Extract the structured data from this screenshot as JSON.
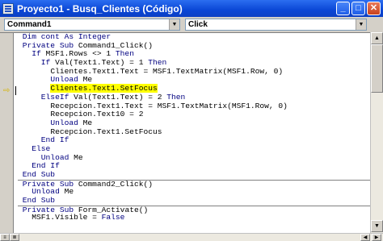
{
  "window": {
    "title": "Proyecto1 - Busq_Clientes (Código)"
  },
  "object_combo": {
    "value": "Command1"
  },
  "procedure_combo": {
    "value": "Click"
  },
  "code_lines": [
    {
      "indent": 1,
      "parts": [
        {
          "t": "Dim cont As Integer",
          "k": true
        }
      ]
    },
    {
      "indent": 1,
      "parts": [
        {
          "t": "Private Sub",
          "k": true
        },
        {
          "t": " Command1_Click()"
        }
      ]
    },
    {
      "indent": 3,
      "parts": [
        {
          "t": "If",
          "k": true
        },
        {
          "t": " MSF1.Rows <> 1 "
        },
        {
          "t": "Then",
          "k": true
        }
      ]
    },
    {
      "indent": 5,
      "parts": [
        {
          "t": "If",
          "k": true
        },
        {
          "t": " Val(Text1.Text) = 1 "
        },
        {
          "t": "Then",
          "k": true
        }
      ]
    },
    {
      "indent": 7,
      "parts": [
        {
          "t": "Clientes.Text1.Text = MSF1.TextMatrix(MSF1.Row, 0)"
        }
      ]
    },
    {
      "indent": 7,
      "parts": [
        {
          "t": "Unload",
          "k": true
        },
        {
          "t": " Me"
        }
      ]
    },
    {
      "indent": 7,
      "parts": [
        {
          "t": "Clientes.Text1.SetFocus",
          "h": true
        }
      ]
    },
    {
      "indent": 5,
      "parts": [
        {
          "t": "ElseIf",
          "k": true
        },
        {
          "t": " Val(Text1.Text) = 2 "
        },
        {
          "t": "Then",
          "k": true
        }
      ]
    },
    {
      "indent": 7,
      "parts": [
        {
          "t": "Recepcion.Text1.Text = MSF1.TextMatrix(MSF1.Row, 0)"
        }
      ]
    },
    {
      "indent": 7,
      "parts": [
        {
          "t": "Recepcion.Text10 = 2"
        }
      ]
    },
    {
      "indent": 7,
      "parts": [
        {
          "t": "Unload",
          "k": true
        },
        {
          "t": " Me"
        }
      ]
    },
    {
      "indent": 7,
      "parts": [
        {
          "t": "Recepcion.Text1.SetFocus"
        }
      ]
    },
    {
      "indent": 5,
      "parts": [
        {
          "t": "End If",
          "k": true
        }
      ]
    },
    {
      "indent": 3,
      "parts": [
        {
          "t": "Else",
          "k": true
        }
      ]
    },
    {
      "indent": 5,
      "parts": [
        {
          "t": "Unload",
          "k": true
        },
        {
          "t": " Me"
        }
      ]
    },
    {
      "indent": 3,
      "parts": [
        {
          "t": "End If",
          "k": true
        }
      ]
    },
    {
      "indent": 1,
      "parts": [
        {
          "t": "End Sub",
          "k": true
        }
      ]
    },
    {
      "indent": 1,
      "sep": true,
      "parts": [
        {
          "t": "Private Sub",
          "k": true
        },
        {
          "t": " Command2_Click()"
        }
      ]
    },
    {
      "indent": 3,
      "parts": [
        {
          "t": "Unload",
          "k": true
        },
        {
          "t": " Me"
        }
      ]
    },
    {
      "indent": 1,
      "parts": [
        {
          "t": "End Sub",
          "k": true
        }
      ]
    },
    {
      "indent": 1,
      "sep": true,
      "parts": [
        {
          "t": "Private Sub",
          "k": true
        },
        {
          "t": " Form_Activate()"
        }
      ]
    },
    {
      "indent": 3,
      "parts": [
        {
          "t": "MSF1.Visible = "
        },
        {
          "t": "False",
          "k": true
        }
      ]
    }
  ],
  "colors": {
    "keyword": "#000080",
    "highlight": "#ffff00",
    "titlebar": "#0a46d6"
  },
  "icons": {
    "app": "code-window-icon",
    "current_line": "execution-arrow-icon"
  }
}
